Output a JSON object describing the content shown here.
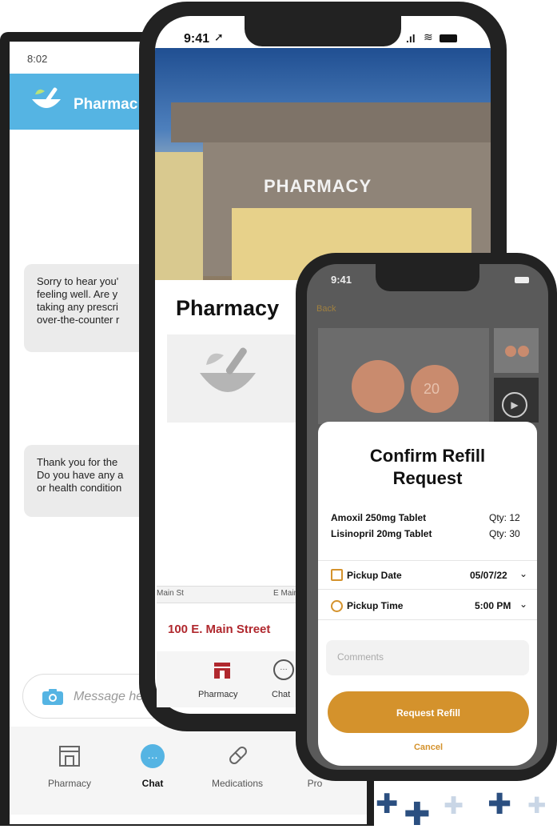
{
  "colors": {
    "accent_blue": "#55b4e3",
    "accent_red": "#b0282e",
    "accent_orange": "#d4922c",
    "navy": "#2b4f80"
  },
  "chat_app": {
    "status_time": "8:02",
    "header_title": "Pharmac",
    "messages": [
      {
        "text": "Sorry to hear you'\nfeeling well. Are y\ntaking any prescri\nover-the-counter r"
      },
      {
        "text": "Thank you for the\nDo you have any a\nor health condition"
      }
    ],
    "composer_placeholder": "Message he",
    "tabs": [
      {
        "label": "Pharmacy",
        "icon": "storefront-icon"
      },
      {
        "label": "Chat",
        "icon": "chat-bubble-icon"
      },
      {
        "label": "Medications",
        "icon": "pill-icon"
      },
      {
        "label": "Pro",
        "icon": "profile-icon"
      }
    ]
  },
  "pharmacy_app": {
    "status_time": "9:41",
    "building_sign": "PHARMACY",
    "title": "Pharmacy",
    "map_streets": [
      "Main St",
      "E Main"
    ],
    "address": "100 E. Main Street",
    "tabs": [
      {
        "label": "Pharmacy",
        "icon": "storefront-icon"
      },
      {
        "label": "Chat",
        "icon": "chat-bubble-icon"
      }
    ]
  },
  "refill_app": {
    "status_time": "9:41",
    "back_label": "Back",
    "pill_text": "20",
    "sheet_title": "Confirm Refill Request",
    "items": [
      {
        "name": "Amoxil 250mg Tablet",
        "qty": "Qty: 12"
      },
      {
        "name": "Lisinopril 20mg Tablet",
        "qty": "Qty: 30"
      }
    ],
    "pickup_date_label": "Pickup Date",
    "pickup_date_value": "05/07/22",
    "pickup_time_label": "Pickup Time",
    "pickup_time_value": "5:00 PM",
    "comments_placeholder": "Comments",
    "request_button": "Request Refill",
    "cancel_button": "Cancel"
  }
}
